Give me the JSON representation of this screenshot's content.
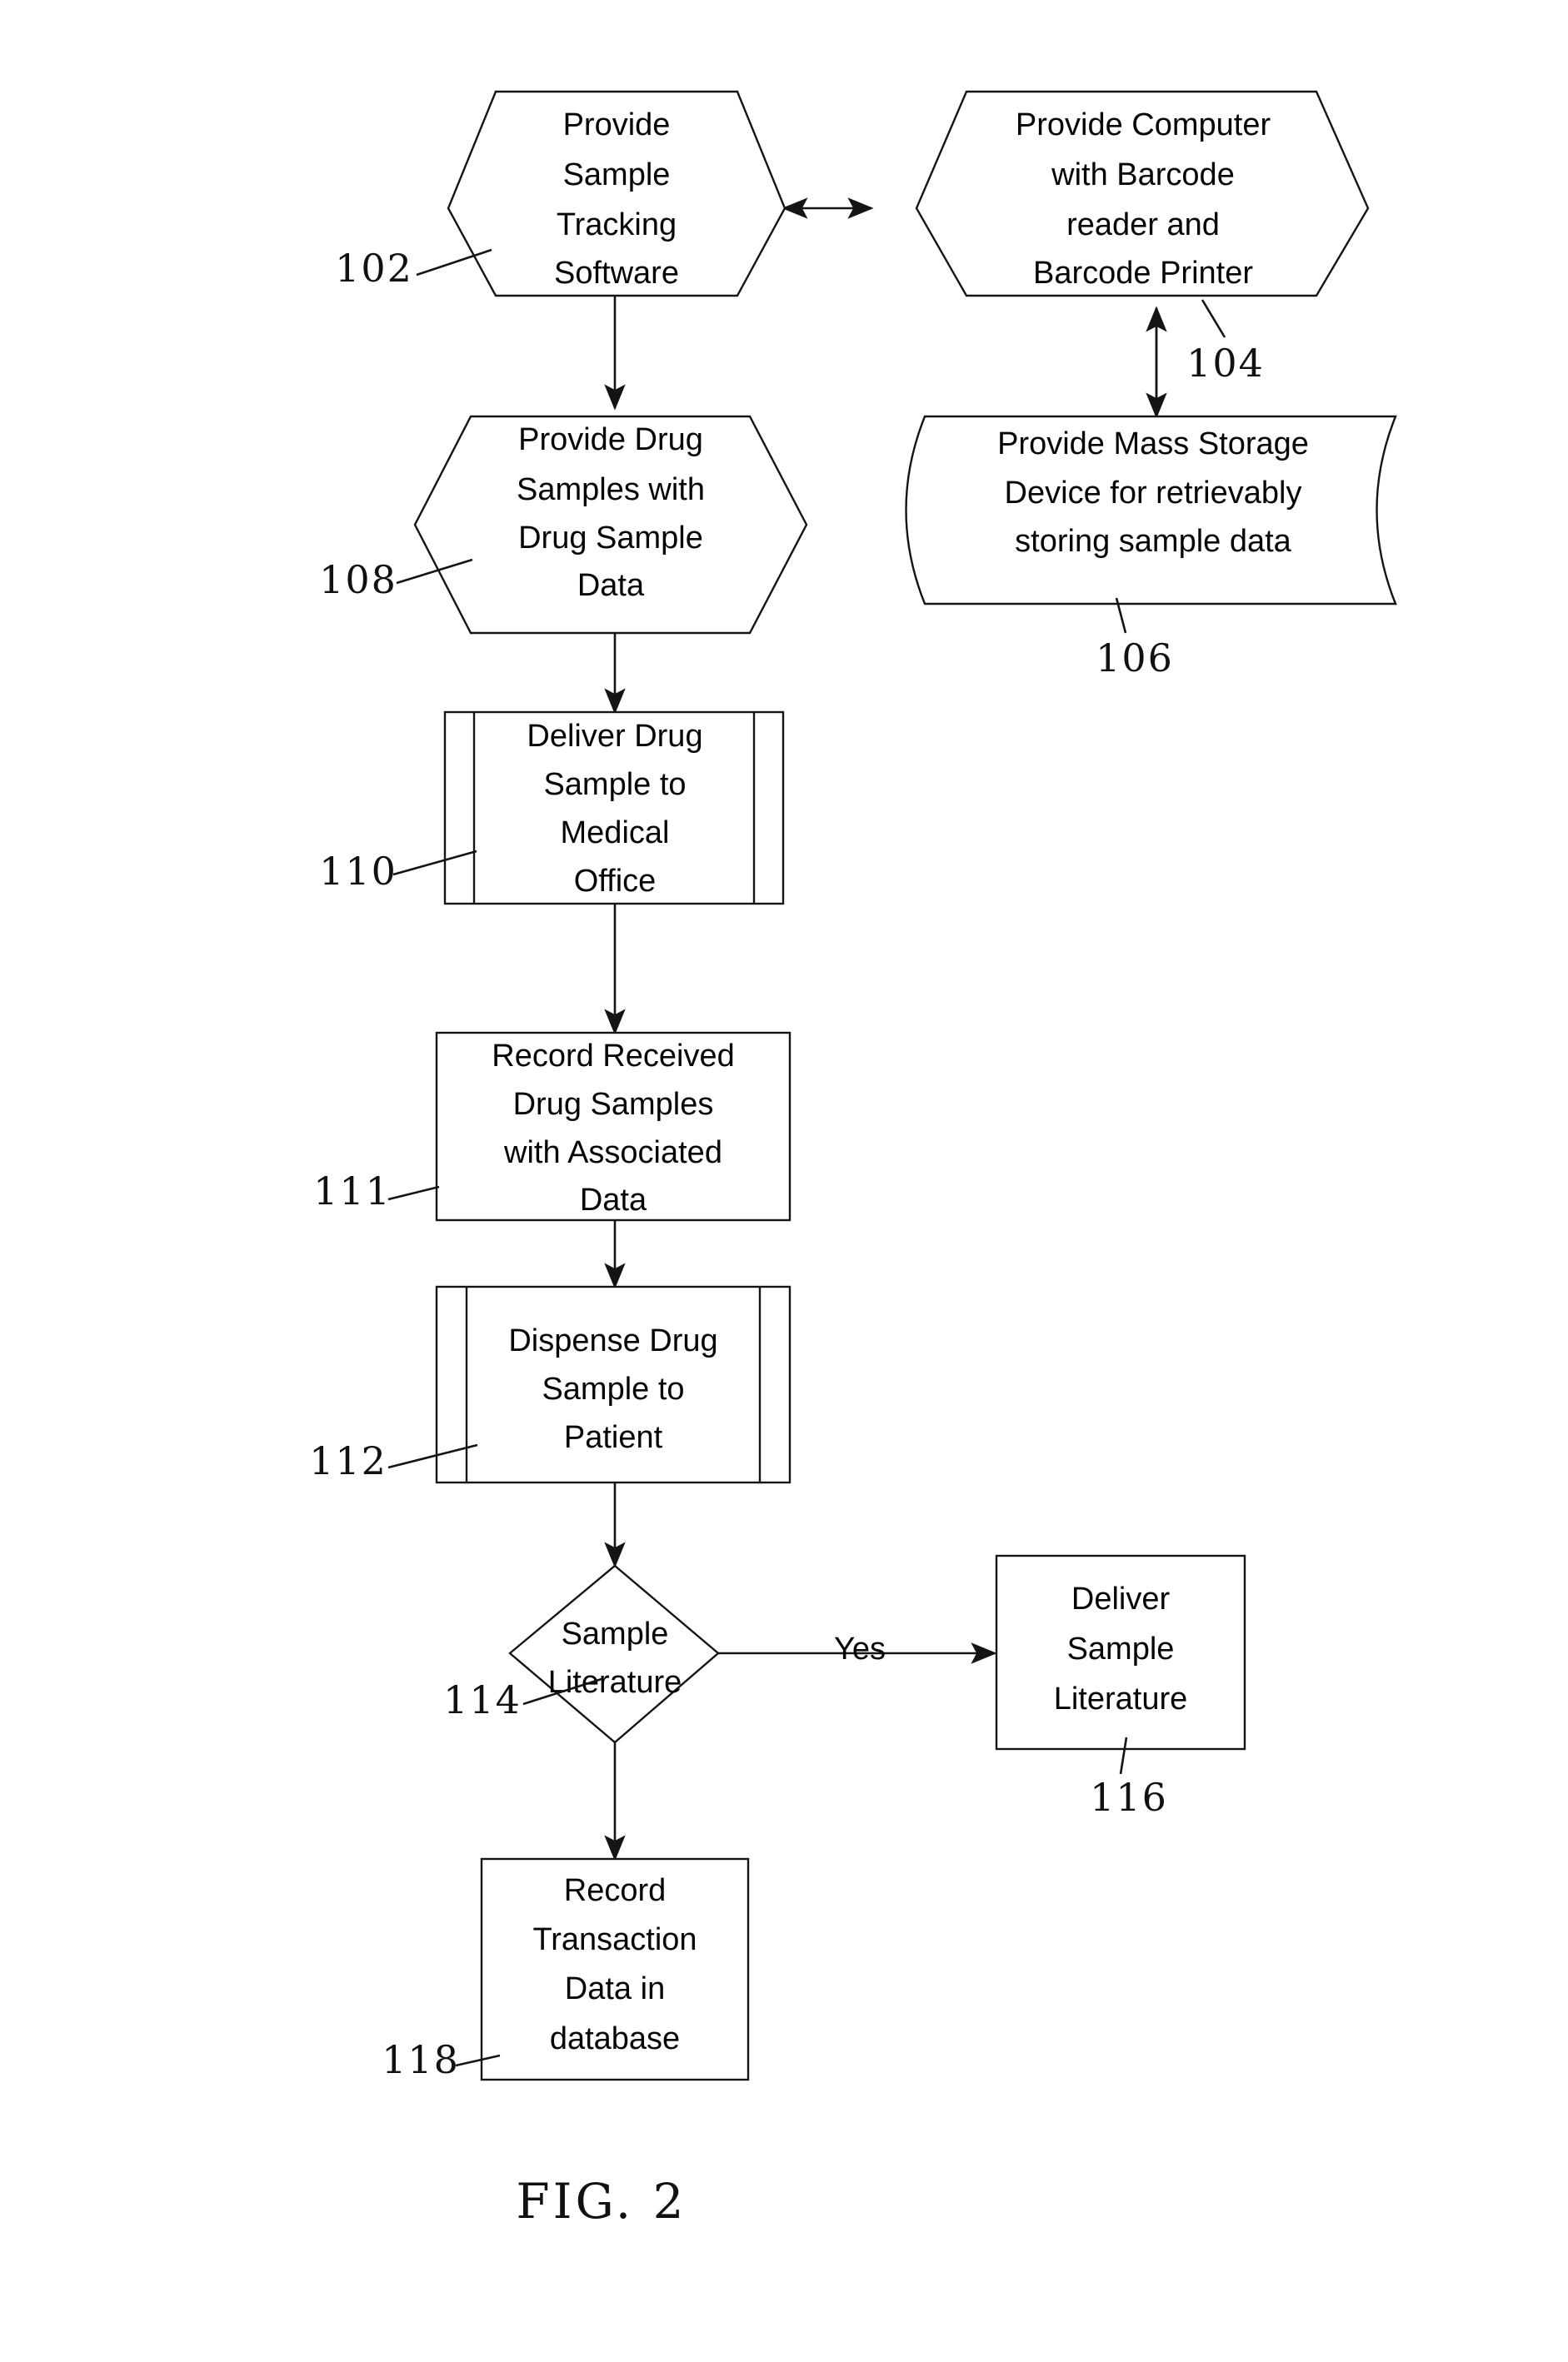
{
  "figure": {
    "caption": "FIG. 2",
    "yes_label": "Yes"
  },
  "nodes": {
    "n102": {
      "ref": "102",
      "shape": "hexagon",
      "lines": [
        "Provide",
        "Sample",
        "Tracking",
        "Software"
      ]
    },
    "n104": {
      "ref": "104",
      "shape": "hexagon",
      "lines": [
        "Provide Computer",
        "with Barcode",
        "reader and",
        "Barcode Printer"
      ]
    },
    "n108": {
      "ref": "108",
      "shape": "hexagon",
      "lines": [
        "Provide Drug",
        "Samples with",
        "Drug Sample",
        "Data"
      ]
    },
    "n106": {
      "ref": "106",
      "shape": "stored-data",
      "lines": [
        "Provide Mass Storage",
        "Device for retrievably",
        "storing sample data"
      ]
    },
    "n110": {
      "ref": "110",
      "shape": "predefined-process",
      "lines": [
        "Deliver Drug",
        "Sample to",
        "Medical",
        "Office"
      ]
    },
    "n111": {
      "ref": "111",
      "shape": "rectangle",
      "lines": [
        "Record Received",
        "Drug Samples",
        "with Associated",
        "Data"
      ]
    },
    "n112": {
      "ref": "112",
      "shape": "predefined-process",
      "lines": [
        "Dispense Drug",
        "Sample to",
        "Patient"
      ]
    },
    "n114": {
      "ref": "114",
      "shape": "diamond",
      "lines": [
        "Sample",
        "Literature"
      ]
    },
    "n116": {
      "ref": "116",
      "shape": "rectangle",
      "lines": [
        "Deliver",
        "Sample",
        "Literature"
      ]
    },
    "n118": {
      "ref": "118",
      "shape": "rectangle",
      "lines": [
        "Record",
        "Transaction",
        "Data in",
        "database"
      ]
    }
  },
  "colors": {
    "ink": "#141414",
    "paper": "#ffffff"
  }
}
